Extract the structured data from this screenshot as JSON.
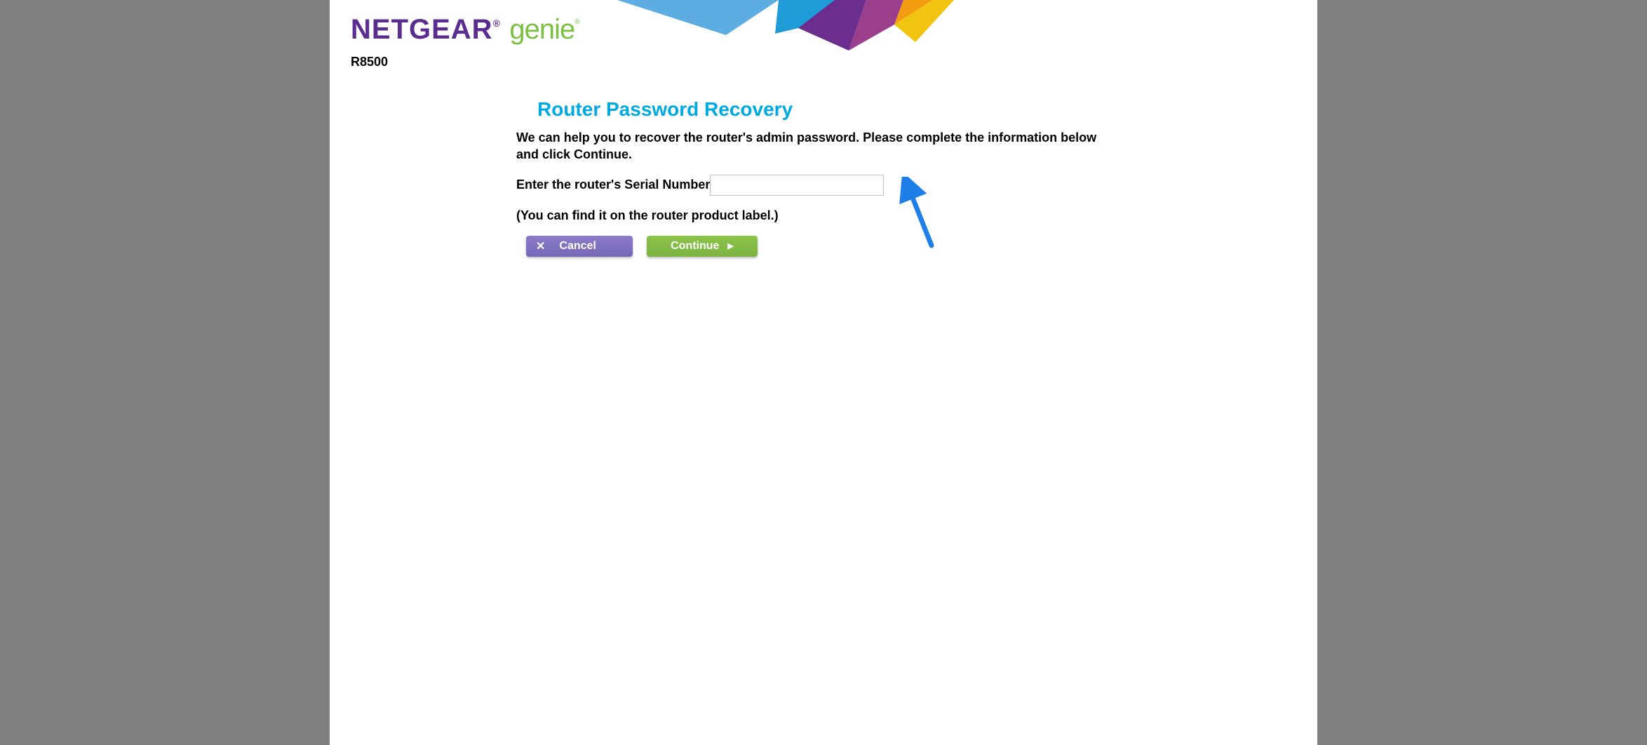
{
  "header": {
    "brand_netgear": "NETGEAR",
    "brand_genie": "genie",
    "model": "R8500"
  },
  "main": {
    "title": "Router Password Recovery",
    "description": "We can help you to recover the router's admin password. Please complete the information below and click Continue.",
    "serial_label": "Enter the router's Serial Number",
    "serial_value": "",
    "hint": "(You can find it on the router product label.)"
  },
  "buttons": {
    "cancel_label": "Cancel",
    "continue_label": "Continue"
  }
}
